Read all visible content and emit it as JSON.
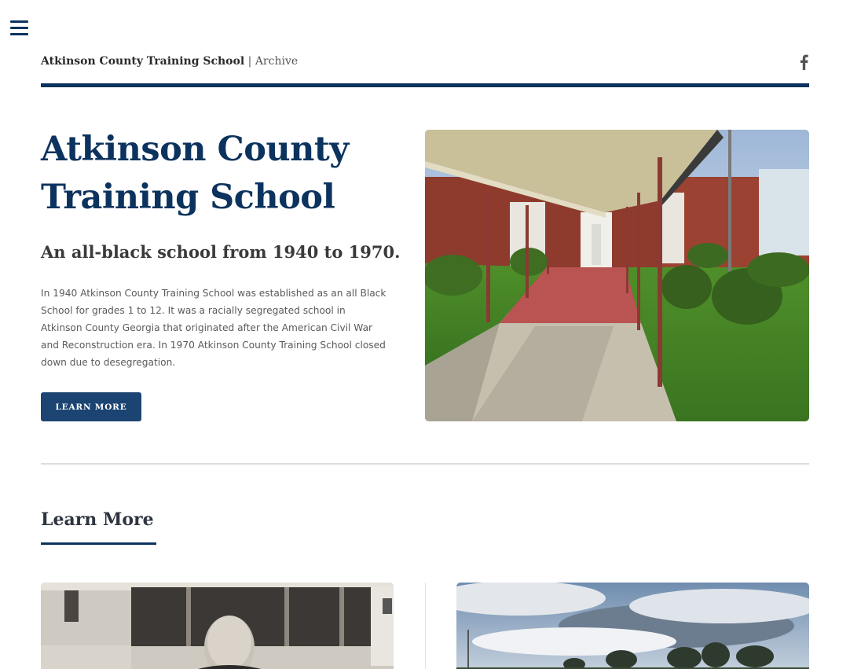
{
  "nav": {
    "menu_icon": "hamburger-menu-icon"
  },
  "header": {
    "site_name": "Atkinson County Training School",
    "separator": "|",
    "section": "Archive",
    "social_icon": "facebook-icon"
  },
  "hero": {
    "title": "Atkinson County Training School",
    "subtitle": "An all-black school from 1940 to 1970.",
    "body": "In 1940 Atkinson County Training School was established as an all Black School for grades 1 to 12. It was a racially segregated school in Atkinson County Georgia that originated after the American Civil War and Reconstruction era. In 1970 Atkinson County Training School closed down due to desegregation.",
    "button_label": "LEARN MORE"
  },
  "learn_more": {
    "heading": "Learn More"
  },
  "colors": {
    "brand_navy": "#0c335e",
    "button_blue": "#1b4472",
    "divider_gray": "#dcdcdc"
  }
}
